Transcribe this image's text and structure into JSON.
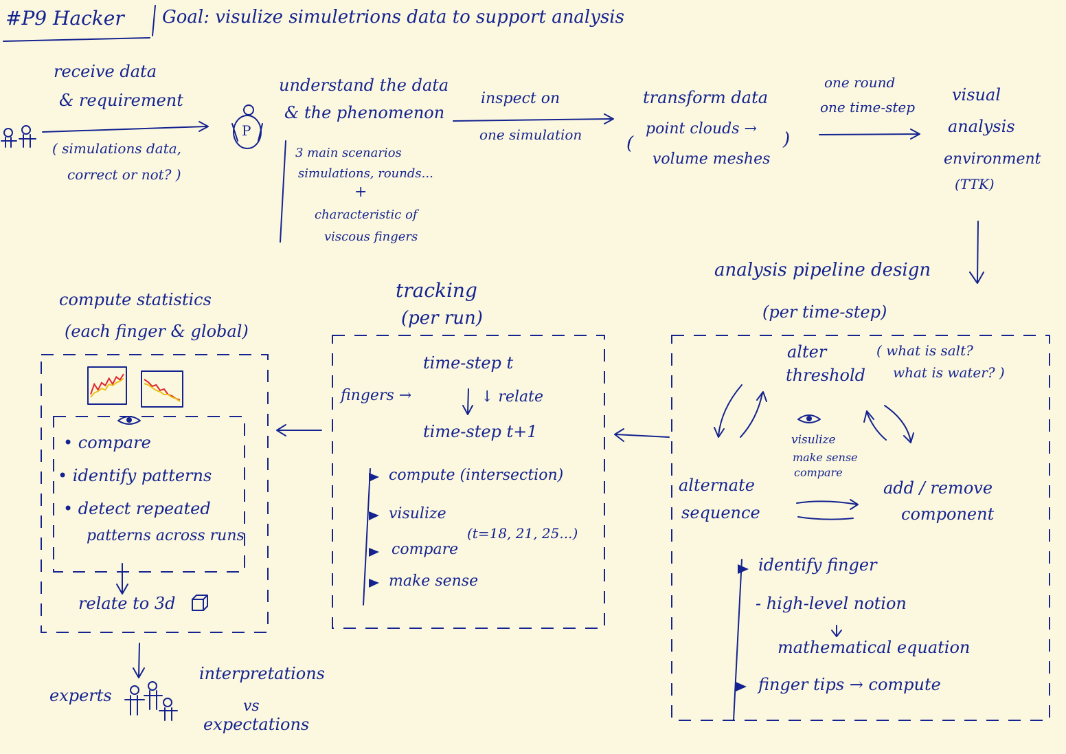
{
  "header": {
    "title": "#P9 Hacker",
    "goal": "Goal: visulize simuletrions data to support analysis"
  },
  "flow": {
    "receive": {
      "line1": "receive data",
      "line2": "& requirement",
      "note1": "( simulations data,",
      "note2": "correct or not? )"
    },
    "understand": {
      "line1": "understand the data",
      "line2": "& the phenomenon",
      "person_letter": "P",
      "note1": "3 main scenarios",
      "note2": "simulations, rounds...",
      "plus": "+",
      "note3": "characteristic of",
      "note4": "viscous fingers"
    },
    "inspect": {
      "above": "inspect on",
      "below": "one simulation"
    },
    "transform": {
      "title": "transform data",
      "line1": "point clouds →",
      "line2": "volume meshes",
      "open_paren": "(",
      "close_paren": ")"
    },
    "oneround": {
      "line1": "one round",
      "line2": "one time-step"
    },
    "visual": {
      "line1": "visual",
      "line2": "analysis",
      "line3": "environment",
      "line4": "(TTK)"
    }
  },
  "pipeline": {
    "title": "analysis pipeline design",
    "subtitle": "(per time-step)",
    "alter1": "alter",
    "alter2": "threshold",
    "question1": "( what is salt?",
    "question2": "what is water? )",
    "center1": "visulize",
    "center2": "make sense",
    "center3": "compare",
    "alt1": "alternate",
    "alt2": "sequence",
    "add1": "add / remove",
    "add2": "component",
    "b1": "identify finger",
    "b2": "- high-level notion",
    "b3": "mathematical equation",
    "b4": "finger tips → compute"
  },
  "tracking": {
    "title": "tracking",
    "subtitle": "(per run)",
    "ts1": "time-step t",
    "fingers": "fingers →",
    "relate": "↓ relate",
    "ts2": "time-step t+1",
    "b1": "compute (intersection)",
    "b2": "visulize",
    "b3": "compare",
    "b4": "make sense",
    "range": "(t=18, 21, 25...)"
  },
  "statistics": {
    "title1": "compute statistics",
    "title2": "(each finger & global)",
    "b1": "• compare",
    "b2": "• identify patterns",
    "b3": "• detect repeated",
    "b3b": "patterns across runs",
    "relate3d": "relate to 3d",
    "chart1_series": [
      [
        0.2,
        0.55,
        0.35,
        0.6,
        0.5,
        0.75,
        0.55,
        0.8,
        0.7,
        0.9
      ],
      [
        0.1,
        0.25,
        0.3,
        0.4,
        0.35,
        0.55,
        0.5,
        0.6,
        0.65,
        0.75
      ]
    ],
    "chart2_series": [
      [
        0.85,
        0.75,
        0.6,
        0.65,
        0.45,
        0.5,
        0.3,
        0.25,
        0.15,
        0.1
      ],
      [
        0.7,
        0.65,
        0.55,
        0.45,
        0.4,
        0.3,
        0.3,
        0.2,
        0.15,
        0.05
      ]
    ],
    "chart_colors": [
      "#e0262b",
      "#e8c21a",
      "#2a8a3a"
    ]
  },
  "experts": {
    "label": "experts",
    "interp1": "interpretations",
    "interp2": "vs",
    "interp3": "expectations"
  }
}
